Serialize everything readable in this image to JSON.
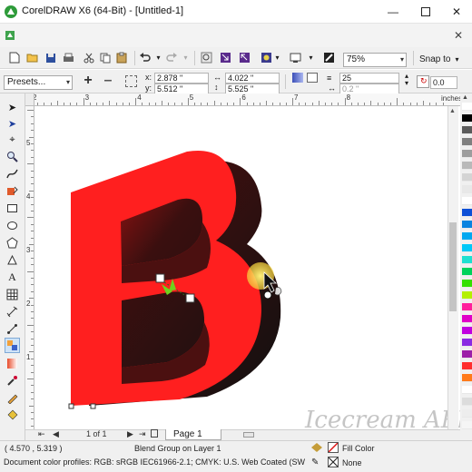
{
  "window": {
    "title": "CorelDRAW X6 (64-Bit) - [Untitled-1]"
  },
  "standard_toolbar": {
    "zoom_value": "75%",
    "snap_to_label": "Snap to"
  },
  "property_bar": {
    "presets_value": "Presets...",
    "x_label": "x:",
    "x_value": "2.878 \"",
    "y_label": "y:",
    "y_value": "5.512 \"",
    "width_value": "4.022 \"",
    "height_value": "5.525 \"",
    "steps_value": "25",
    "spacing_value": "0.2 \"",
    "angle_value": "0.0"
  },
  "ruler": {
    "units_label": "inches",
    "h_numbers": [
      "2",
      "3",
      "4",
      "5",
      "6",
      "7",
      "8"
    ],
    "v_numbers": [
      "5",
      "4",
      "3",
      "2",
      "1"
    ]
  },
  "page_nav": {
    "position": "1 of 1",
    "page_tab_label": "Page 1"
  },
  "status_bar": {
    "coordinates": "( 4.570 , 5.319 )",
    "selection_info": "Blend Group on Layer 1",
    "color_profiles": "Document color profiles: RGB: sRGB IEC61966-2.1; CMYK: U.S. Web Coated (SWO...",
    "fill_label": "Fill Color",
    "outline_label": "None"
  },
  "watermark": {
    "brand_text": "Icecream APPS"
  },
  "colors": {
    "letter_red": "#ff1f1f",
    "extrude_dark": "#1a1a1a",
    "palette": [
      "#ffffff",
      "#000000",
      "#5b5b5b",
      "#7f7f7f",
      "#9d9d9d",
      "#b9b9b9",
      "#d4d4d4",
      "#e8e8e8",
      "#ffffff",
      "#0d4fd6",
      "#0a84e0",
      "#00a8f0",
      "#00c8f8",
      "#1fe0d0",
      "#00d25a",
      "#34e000",
      "#b4f000",
      "#ff1f9c",
      "#e000c8",
      "#c000e0",
      "#8a2be2",
      "#9c1fa8",
      "#ff2d2d",
      "#ff7a1a",
      "#ffffff",
      "#dcdcdc",
      "#ededed",
      "#f5f5f5"
    ]
  },
  "icons": {
    "toolbox": [
      "pick-icon",
      "shape-icon",
      "crop-icon",
      "zoom-icon",
      "freehand-icon",
      "smart-fill-icon",
      "rectangle-icon",
      "ellipse-icon",
      "polygon-icon",
      "text-icon",
      "table-icon",
      "dimension-icon",
      "connector-icon",
      "blend-icon",
      "transparency-icon",
      "eyedropper-icon",
      "outline-icon",
      "fill-icon",
      "interactive-fill-icon"
    ]
  }
}
